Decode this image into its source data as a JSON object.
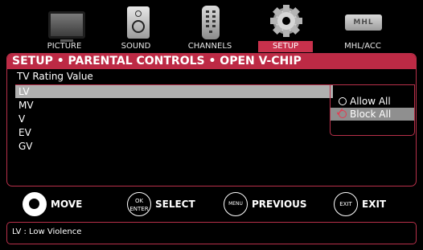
{
  "topbar": {
    "items": [
      {
        "label": "PICTURE",
        "icon": "tv-icon",
        "active": false
      },
      {
        "label": "SOUND",
        "icon": "speaker-icon",
        "active": false
      },
      {
        "label": "CHANNELS",
        "icon": "remote-icon",
        "active": false
      },
      {
        "label": "SETUP",
        "icon": "gear-icon",
        "active": true
      },
      {
        "label": "MHL/ACC",
        "icon": "mhl-logo-icon",
        "active": false
      }
    ],
    "mhl_logo_text": "MHL",
    "accent_color": "#bd2a45"
  },
  "panel": {
    "breadcrumb": "SETUP • PARENTAL CONTROLS • OPEN V-CHIP",
    "section_title": "TV Rating Value",
    "ratings": [
      "LV",
      "MV",
      "V",
      "EV",
      "GV"
    ],
    "selected_rating": "LV",
    "options": [
      "Allow All",
      "Block All"
    ],
    "selected_option": "Block All"
  },
  "keys": {
    "move": {
      "label": "MOVE",
      "icon": "dpad-icon"
    },
    "select": {
      "label": "SELECT",
      "button_text_top": "OK",
      "button_text_bottom": "ENTER"
    },
    "previous": {
      "label": "PREVIOUS",
      "button_text": "MENU"
    },
    "exit": {
      "label": "EXIT",
      "button_text": "EXIT"
    }
  },
  "status": {
    "text": "LV : Low Violence"
  }
}
